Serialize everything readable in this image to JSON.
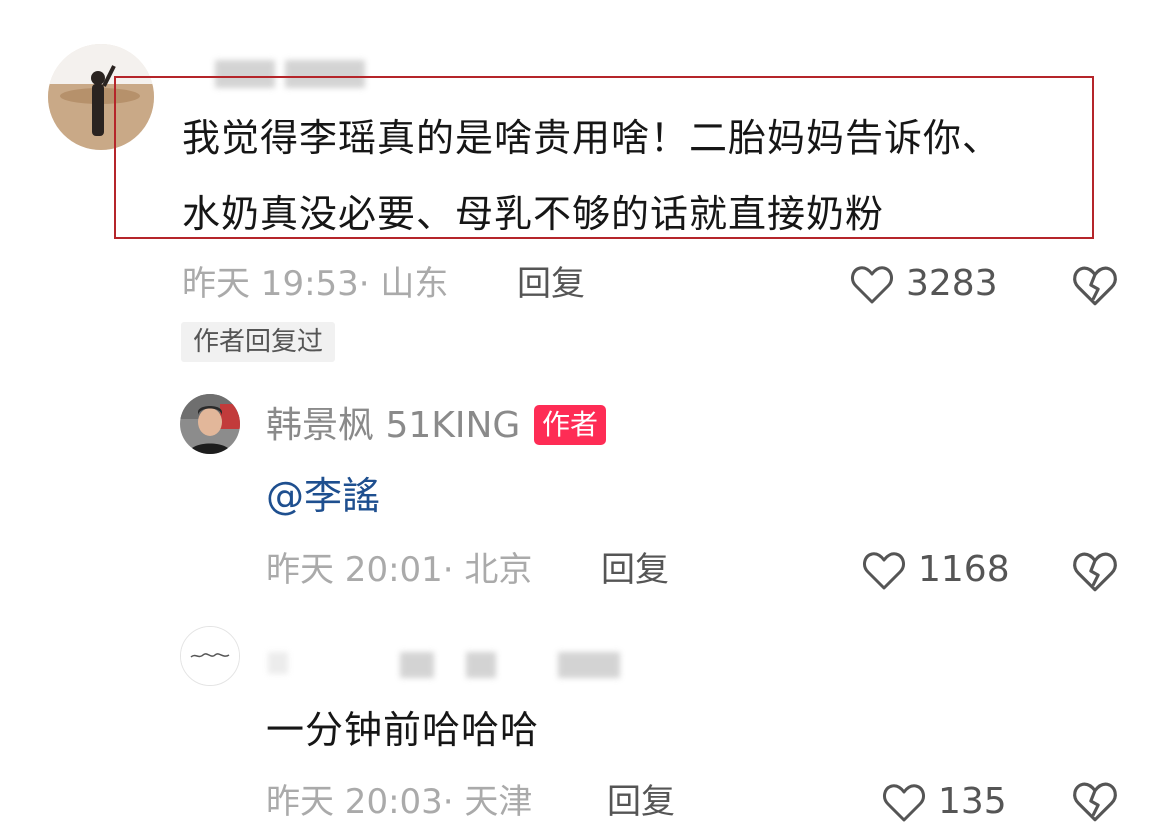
{
  "comments": [
    {
      "username_hidden": true,
      "text_line1": "我觉得李瑶真的是啥贵用啥！二胎妈妈告诉你、",
      "text_line2": "水奶真没必要、母乳不够的话就直接奶粉",
      "time": "昨天 19:53· 山东",
      "reply_label": "回复",
      "likes": "3283",
      "author_replied_tag": "作者回复过"
    },
    {
      "username": "韩景枫 51KING",
      "author_badge": "作者",
      "mention": "@李謠",
      "time": "昨天 20:01· 北京",
      "reply_label": "回复",
      "likes": "1168"
    },
    {
      "username_hidden": true,
      "text": "一分钟前哈哈哈",
      "time": "昨天 20:03· 天津",
      "reply_label": "回复",
      "likes": "135"
    }
  ],
  "icons": {
    "like": "heart-outline-icon",
    "dislike": "broken-heart-icon"
  },
  "colors": {
    "author_badge": "#fe2c55",
    "mention": "#1e4f8f",
    "highlight_box": "#b5252a"
  }
}
